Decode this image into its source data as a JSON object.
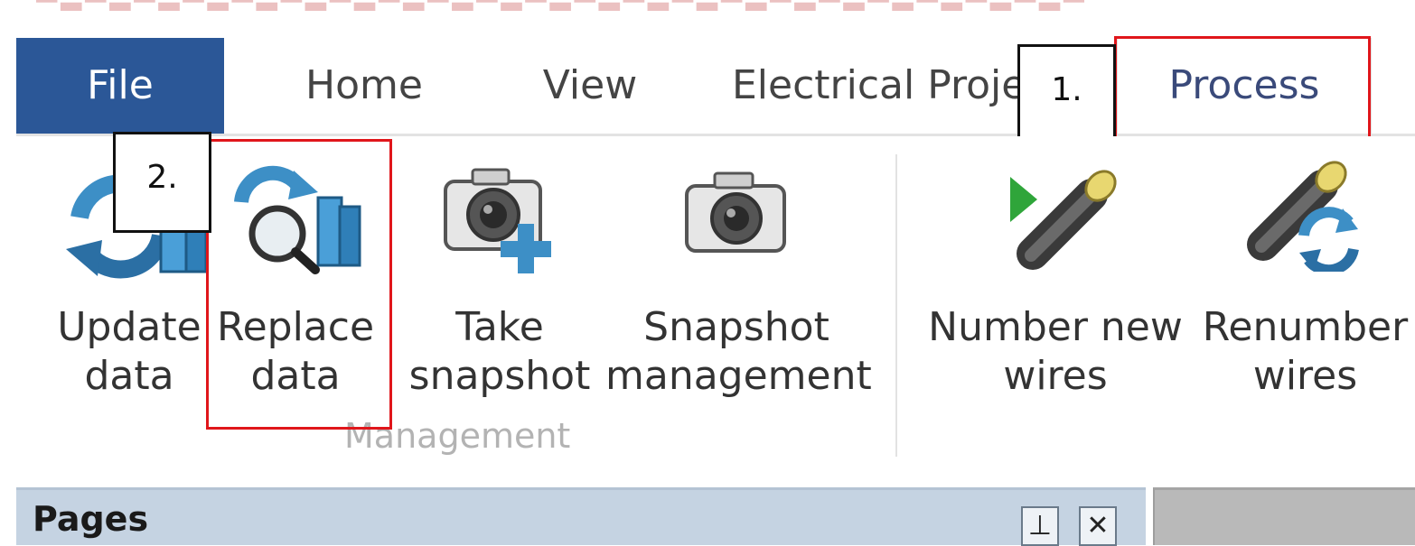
{
  "tabs": {
    "file": "File",
    "home": "Home",
    "view": "View",
    "electrical": "Electrical Proje",
    "process": "Process"
  },
  "callouts": {
    "step1": "1.",
    "step2": "2."
  },
  "ribbon": {
    "buttons": [
      {
        "line1": "Update",
        "line2": "data",
        "icon": "update-data-icon"
      },
      {
        "line1": "Replace",
        "line2": "data",
        "icon": "replace-data-icon"
      },
      {
        "line1": "Take",
        "line2": "snapshot",
        "icon": "camera-add-icon"
      },
      {
        "line1": "Snapshot",
        "line2": "management",
        "icon": "camera-icon"
      },
      {
        "line1": "Number new",
        "line2": "wires",
        "icon": "wire-number-icon"
      },
      {
        "line1": "Renumber",
        "line2": "wires",
        "icon": "wire-renumber-icon"
      }
    ],
    "group_label": "Management"
  },
  "panel": {
    "title": "Pages",
    "pin_glyph": "⊥",
    "close_glyph": "✕"
  },
  "colors": {
    "file_tab": "#2b5797",
    "highlight": "#e0161b",
    "panel_header": "#c5d3e2",
    "accent_blue": "#3d8fc6",
    "wire_yellow": "#e8d770",
    "wire_green": "#2fa53a"
  }
}
